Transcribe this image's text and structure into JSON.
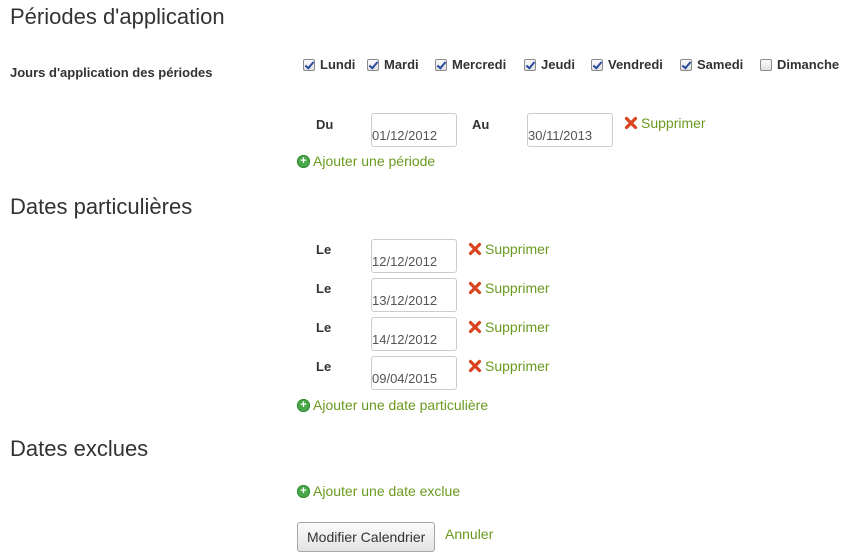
{
  "periods": {
    "title": "Périodes d'application",
    "days_label": "Jours d'application des périodes",
    "days": [
      {
        "label": "Lundi",
        "checked": true
      },
      {
        "label": "Mardi",
        "checked": true
      },
      {
        "label": "Mercredi",
        "checked": true
      },
      {
        "label": "Jeudi",
        "checked": true
      },
      {
        "label": "Vendredi",
        "checked": true
      },
      {
        "label": "Samedi",
        "checked": true
      },
      {
        "label": "Dimanche",
        "checked": false
      }
    ],
    "range": {
      "from_label": "Du",
      "from_value": "01/12/2012",
      "to_label": "Au",
      "to_value": "30/11/2013",
      "delete_label": "Supprimer"
    },
    "add_label": "Ajouter une période"
  },
  "specific_dates": {
    "title": "Dates particulières",
    "items": [
      {
        "label": "Le",
        "value": "12/12/2012",
        "delete_label": "Supprimer"
      },
      {
        "label": "Le",
        "value": "13/12/2012",
        "delete_label": "Supprimer"
      },
      {
        "label": "Le",
        "value": "14/12/2012",
        "delete_label": "Supprimer"
      },
      {
        "label": "Le",
        "value": "09/04/2015",
        "delete_label": "Supprimer"
      }
    ],
    "add_label": "Ajouter une date particulière"
  },
  "excluded_dates": {
    "title": "Dates exclues",
    "add_label": "Ajouter une date exclue"
  },
  "actions": {
    "submit_label": "Modifier Calendrier",
    "cancel_label": "Annuler"
  },
  "colors": {
    "link": "#6a9a1f",
    "delete": "#d9431e",
    "add": "#4aa84a"
  },
  "icons": {
    "delete": "red-x-icon",
    "add": "green-plus-circle-icon",
    "checkbox": "checkbox-icon"
  }
}
